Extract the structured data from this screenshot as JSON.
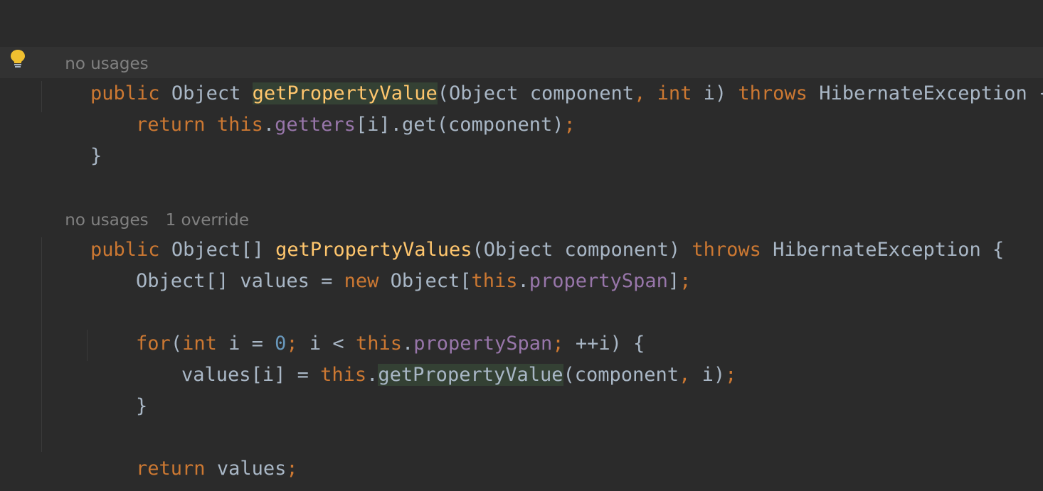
{
  "colors": {
    "background": "#2b2b2b",
    "keyword": "#cc7832",
    "method_declaration": "#ffc66d",
    "field": "#9876aa",
    "number": "#6897bb",
    "default_text": "#a9b7c6",
    "inlay_hint": "#808080",
    "usage_highlight": "#344134"
  },
  "gutter": {
    "intention_icon": "lightbulb-icon"
  },
  "hints": {
    "method1_usages": "no usages",
    "method2_usages": "no usages",
    "method2_overrides": "1 override"
  },
  "code": {
    "l1": {
      "t1": "public",
      "t2": " Object ",
      "t3": "getPropertyValue",
      "t4": "(Object component",
      "t5": ", ",
      "t6": "int",
      "t7": " i) ",
      "t8": "throws",
      "t9": " HibernateException {"
    },
    "l2": {
      "t1": "return ",
      "t2": "this",
      "t3": ".",
      "t4": "getters",
      "t5": "[i].get(component)",
      "t6": ";"
    },
    "l3": {
      "t1": "}"
    },
    "l4": {
      "t1": "public",
      "t2": " Object[] ",
      "t3": "getPropertyValues",
      "t4": "(Object component) ",
      "t5": "throws",
      "t6": " HibernateException {"
    },
    "l5": {
      "t1": "Object[] values = ",
      "t2": "new",
      "t3": " Object[",
      "t4": "this",
      "t5": ".",
      "t6": "propertySpan",
      "t7": "]",
      "t8": ";"
    },
    "l6": {
      "t1": "for",
      "t2": "(",
      "t3": "int",
      "t4": " i = ",
      "t5": "0",
      "t6": "; ",
      "t7": "i < ",
      "t8": "this",
      "t9": ".",
      "t10": "propertySpan",
      "t11": "; ",
      "t12": "++i) {"
    },
    "l7": {
      "t1": "values[i] = ",
      "t2": "this",
      "t3": ".",
      "t4": "getPropertyValue",
      "t5": "(component",
      "t6": ", ",
      "t7": "i)",
      "t8": ";"
    },
    "l8": {
      "t1": "}"
    },
    "l9": {
      "t1": "return ",
      "t2": "values",
      "t3": ";"
    },
    "l10": {
      "t1": "}"
    }
  }
}
